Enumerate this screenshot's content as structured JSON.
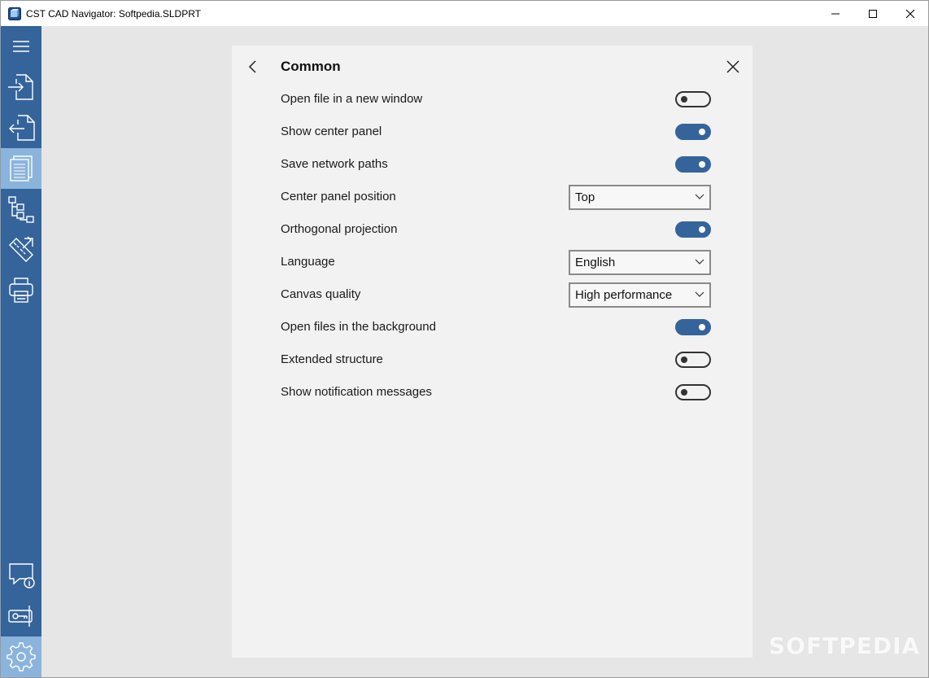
{
  "window": {
    "title": "CST CAD Navigator: Softpedia.SLDPRT",
    "minimize_icon": "minimize-icon",
    "maximize_icon": "maximize-icon",
    "close_icon": "close-icon"
  },
  "sidebar": {
    "items": [
      {
        "icon": "hamburger-menu-icon"
      },
      {
        "icon": "import-file-icon"
      },
      {
        "icon": "export-file-icon"
      },
      {
        "icon": "documents-icon",
        "active": true
      },
      {
        "icon": "structure-tree-icon"
      },
      {
        "icon": "measure-tools-icon"
      },
      {
        "icon": "print-icon"
      },
      {
        "icon": "feedback-info-icon"
      },
      {
        "icon": "license-key-icon"
      },
      {
        "icon": "settings-gear-icon",
        "active": true
      }
    ]
  },
  "settings": {
    "title": "Common",
    "back_icon": "chevron-left-icon",
    "close_icon": "close-icon",
    "rows": [
      {
        "label": "Open file in a new window",
        "type": "toggle",
        "on": false
      },
      {
        "label": "Show center panel",
        "type": "toggle",
        "on": true
      },
      {
        "label": "Save network paths",
        "type": "toggle",
        "on": true
      },
      {
        "label": "Center panel position",
        "type": "select",
        "value": "Top"
      },
      {
        "label": "Orthogonal projection",
        "type": "toggle",
        "on": true
      },
      {
        "label": "Language",
        "type": "select",
        "value": "English"
      },
      {
        "label": "Canvas quality",
        "type": "select",
        "value": "High performance"
      },
      {
        "label": "Open files in the background",
        "type": "toggle",
        "on": true
      },
      {
        "label": "Extended structure",
        "type": "toggle",
        "on": false
      },
      {
        "label": "Show notification messages",
        "type": "toggle",
        "on": false
      }
    ]
  },
  "watermark": "SOFTPEDIA",
  "colors": {
    "sidebar": "#35649b",
    "sidebar_active": "#8bb4dc",
    "toggle_on": "#35649b",
    "panel": "#f2f2f2",
    "background": "#e6e6e6"
  }
}
